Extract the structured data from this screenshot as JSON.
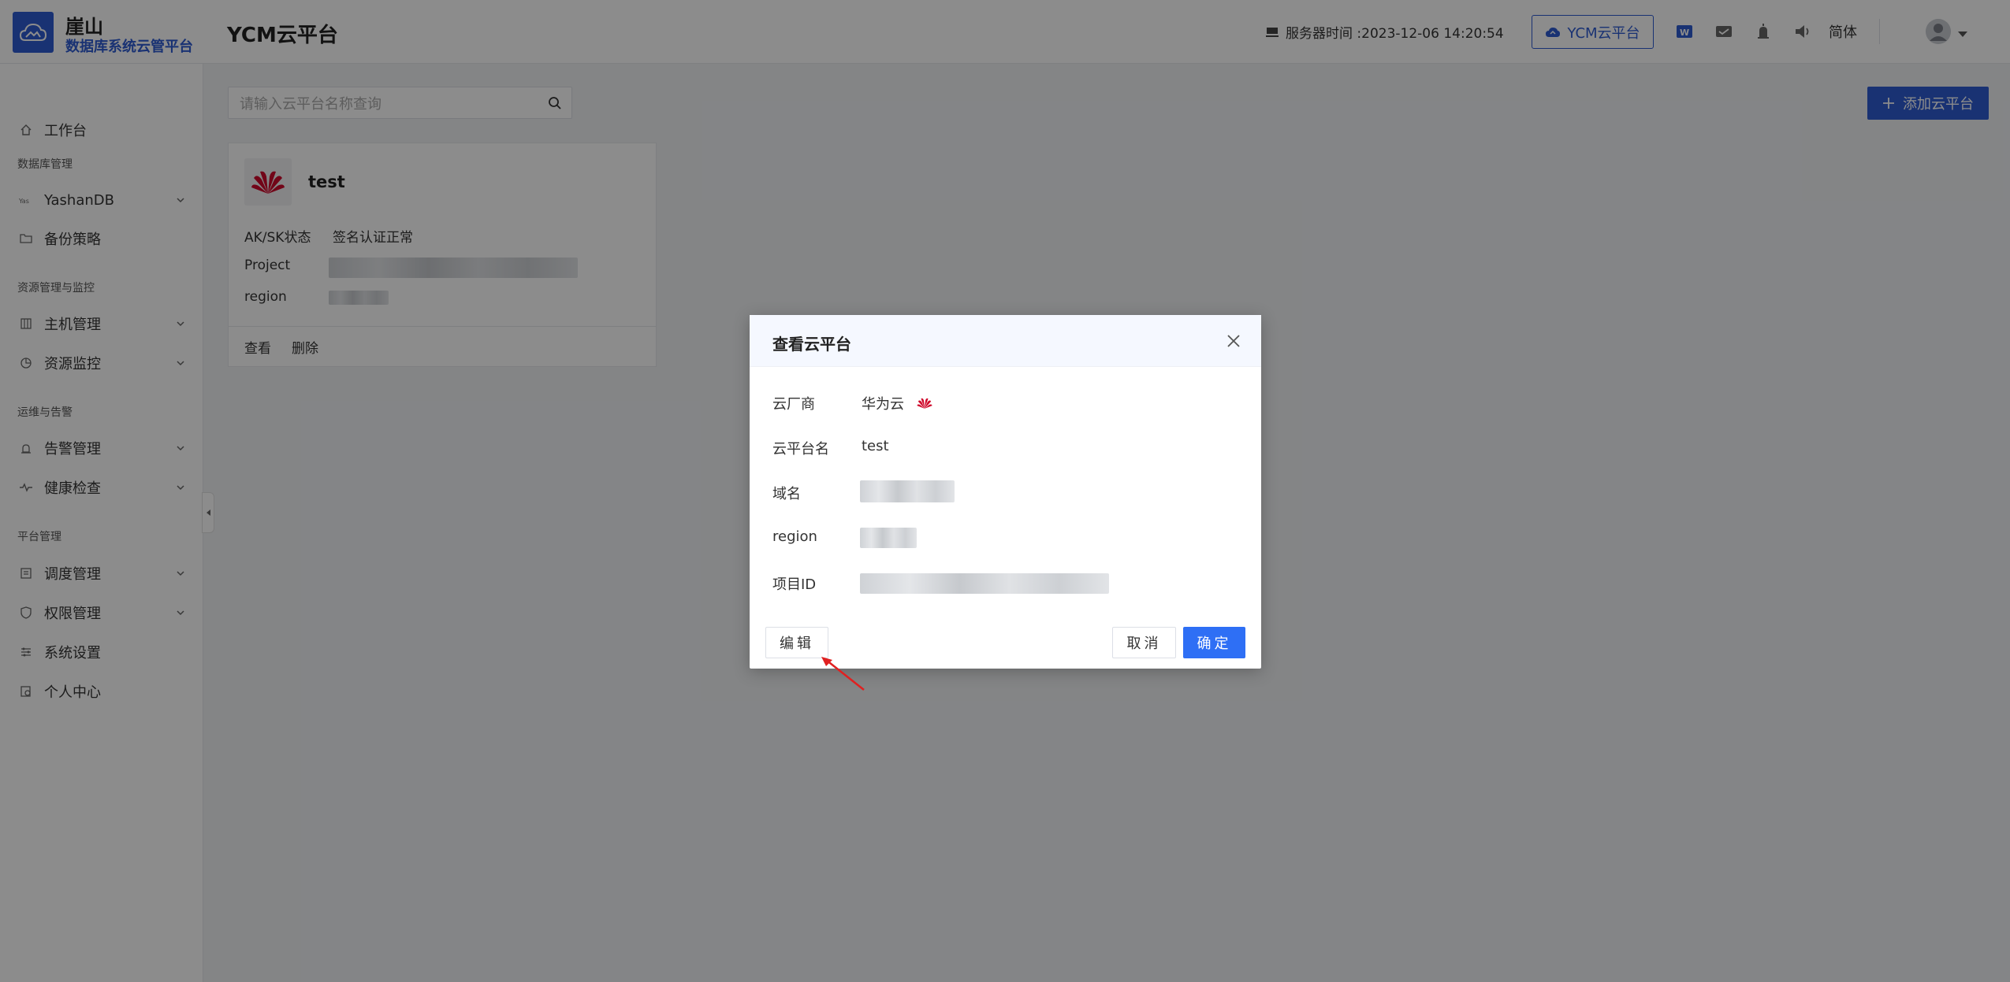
{
  "header": {
    "logo_title": "崖山",
    "logo_subtitle": "数据库系统云管平台",
    "page_title": "YCM云平台",
    "server_time": "服务器时间 :2023-12-06 14:20:54",
    "cloud_button": "YCM云平台",
    "lang": "简体"
  },
  "sidebar": {
    "workbench": "工作台",
    "group_db": "数据库管理",
    "yashandb": "YashanDB",
    "backup": "备份策略",
    "group_res": "资源管理与监控",
    "host": "主机管理",
    "monitor": "资源监控",
    "group_ops": "运维与告警",
    "alarm": "告警管理",
    "health": "健康检查",
    "group_platform": "平台管理",
    "schedule": "调度管理",
    "permission": "权限管理",
    "settings": "系统设置",
    "profile": "个人中心"
  },
  "main": {
    "search_placeholder": "请输入云平台名称查询",
    "add_button": "添加云平台",
    "card": {
      "name": "test",
      "aksk_label": "AK/SK状态",
      "aksk_value": "签名认证正常",
      "project_label": "Project",
      "region_label": "region",
      "view": "查看",
      "delete": "删除"
    }
  },
  "modal": {
    "title": "查看云平台",
    "vendor_label": "云厂商",
    "vendor_value": "华为云",
    "name_label": "云平台名",
    "name_value": "test",
    "domain_label": "域名",
    "region_label": "region",
    "project_label": "项目ID",
    "edit": "编辑",
    "cancel": "取消",
    "ok": "确定"
  },
  "colors": {
    "primary": "#2e5bd1",
    "button_blue": "#2e6ff5",
    "huawei_red": "#cf0a2c",
    "annotation_red": "#e02020"
  }
}
